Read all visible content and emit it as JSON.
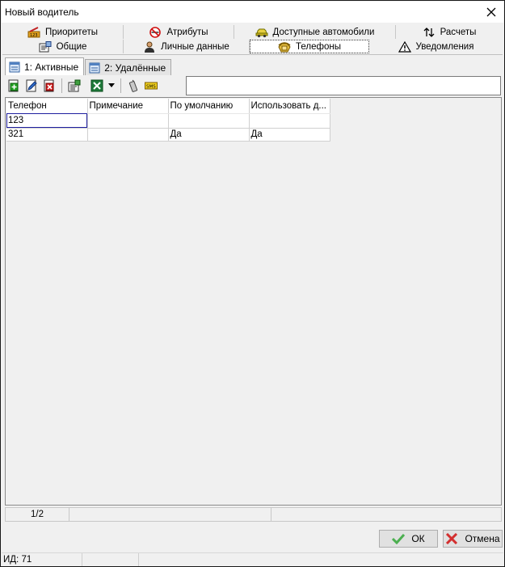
{
  "window": {
    "title": "Новый водитель"
  },
  "tabs_row1": [
    {
      "label": "Приоритеты",
      "icon": "priority-icon"
    },
    {
      "label": "Атрибуты",
      "icon": "no-smoking-icon"
    },
    {
      "label": "Доступные автомобили",
      "icon": "car-icon"
    },
    {
      "label": "Расчеты",
      "icon": "up-down-arrows-icon"
    }
  ],
  "tabs_row2": [
    {
      "label": "Общие",
      "icon": "properties-icon"
    },
    {
      "label": "Личные данные",
      "icon": "person-icon"
    },
    {
      "label": "Телефоны",
      "icon": "phone-icon",
      "active": true
    },
    {
      "label": "Уведомления",
      "icon": "warning-icon"
    }
  ],
  "subtabs": [
    {
      "label": "1: Активные",
      "active": true
    },
    {
      "label": "2: Удалённые",
      "active": false
    }
  ],
  "search": {
    "value": ""
  },
  "grid": {
    "columns": [
      "Телефон",
      "Примечание",
      "По умолчанию",
      "Использовать д..."
    ],
    "rows": [
      [
        "123",
        "",
        "",
        ""
      ],
      [
        "321",
        "",
        "Да",
        "Да"
      ]
    ]
  },
  "grid_status": {
    "position": "1/2"
  },
  "buttons": {
    "ok": "ОК",
    "cancel": "Отмена"
  },
  "statusbar": {
    "id": "ИД: 71"
  },
  "colors": {
    "accent_green": "#4caf50",
    "cancel_red": "#d32f2f",
    "focus": "#2020a0"
  }
}
